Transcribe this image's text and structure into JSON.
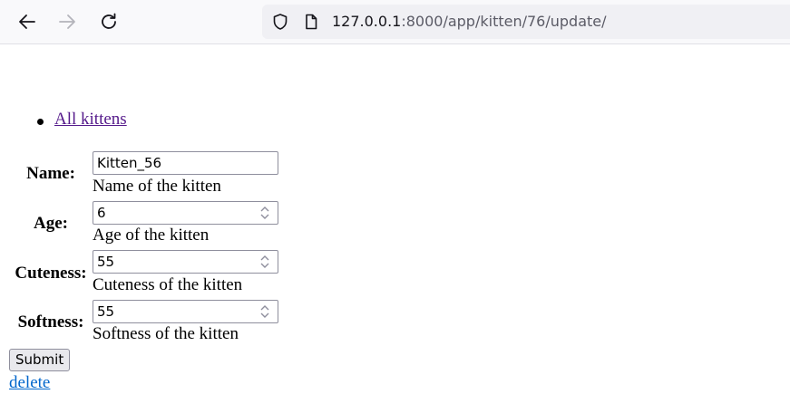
{
  "browser": {
    "url_host": "127.0.0.1",
    "url_rest": ":8000/app/kitten/76/update/",
    "icons": [
      "back-arrow-icon",
      "forward-arrow-icon",
      "reload-icon",
      "shield-icon",
      "page-icon"
    ]
  },
  "nav": {
    "all_kittens": "All kittens"
  },
  "form": {
    "fields": [
      {
        "label": "Name:",
        "value": "Kitten_56",
        "help": "Name of the kitten"
      },
      {
        "label": "Age:",
        "value": "6",
        "help": "Age of the kitten"
      },
      {
        "label": "Cuteness:",
        "value": "55",
        "help": "Cuteness of the kitten"
      },
      {
        "label": "Softness:",
        "value": "55",
        "help": "Softness of the kitten"
      }
    ],
    "submit_label": "Submit",
    "delete_label": "delete"
  },
  "colors": {
    "visited_link": "#551a8b",
    "link": "#0066cc"
  }
}
